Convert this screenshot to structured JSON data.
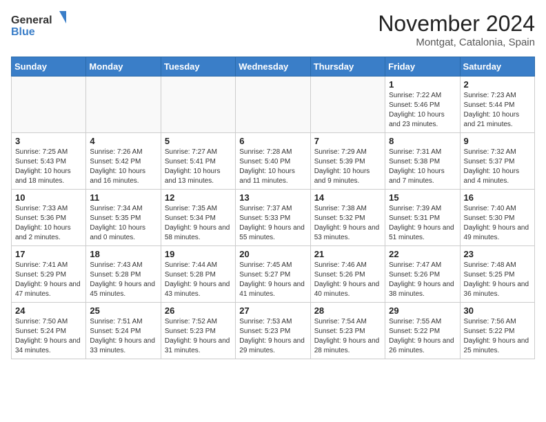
{
  "logo": {
    "general": "General",
    "blue": "Blue"
  },
  "header": {
    "month": "November 2024",
    "location": "Montgat, Catalonia, Spain"
  },
  "days_of_week": [
    "Sunday",
    "Monday",
    "Tuesday",
    "Wednesday",
    "Thursday",
    "Friday",
    "Saturday"
  ],
  "weeks": [
    [
      {
        "day": "",
        "info": ""
      },
      {
        "day": "",
        "info": ""
      },
      {
        "day": "",
        "info": ""
      },
      {
        "day": "",
        "info": ""
      },
      {
        "day": "",
        "info": ""
      },
      {
        "day": "1",
        "info": "Sunrise: 7:22 AM\nSunset: 5:46 PM\nDaylight: 10 hours and 23 minutes."
      },
      {
        "day": "2",
        "info": "Sunrise: 7:23 AM\nSunset: 5:44 PM\nDaylight: 10 hours and 21 minutes."
      }
    ],
    [
      {
        "day": "3",
        "info": "Sunrise: 7:25 AM\nSunset: 5:43 PM\nDaylight: 10 hours and 18 minutes."
      },
      {
        "day": "4",
        "info": "Sunrise: 7:26 AM\nSunset: 5:42 PM\nDaylight: 10 hours and 16 minutes."
      },
      {
        "day": "5",
        "info": "Sunrise: 7:27 AM\nSunset: 5:41 PM\nDaylight: 10 hours and 13 minutes."
      },
      {
        "day": "6",
        "info": "Sunrise: 7:28 AM\nSunset: 5:40 PM\nDaylight: 10 hours and 11 minutes."
      },
      {
        "day": "7",
        "info": "Sunrise: 7:29 AM\nSunset: 5:39 PM\nDaylight: 10 hours and 9 minutes."
      },
      {
        "day": "8",
        "info": "Sunrise: 7:31 AM\nSunset: 5:38 PM\nDaylight: 10 hours and 7 minutes."
      },
      {
        "day": "9",
        "info": "Sunrise: 7:32 AM\nSunset: 5:37 PM\nDaylight: 10 hours and 4 minutes."
      }
    ],
    [
      {
        "day": "10",
        "info": "Sunrise: 7:33 AM\nSunset: 5:36 PM\nDaylight: 10 hours and 2 minutes."
      },
      {
        "day": "11",
        "info": "Sunrise: 7:34 AM\nSunset: 5:35 PM\nDaylight: 10 hours and 0 minutes."
      },
      {
        "day": "12",
        "info": "Sunrise: 7:35 AM\nSunset: 5:34 PM\nDaylight: 9 hours and 58 minutes."
      },
      {
        "day": "13",
        "info": "Sunrise: 7:37 AM\nSunset: 5:33 PM\nDaylight: 9 hours and 55 minutes."
      },
      {
        "day": "14",
        "info": "Sunrise: 7:38 AM\nSunset: 5:32 PM\nDaylight: 9 hours and 53 minutes."
      },
      {
        "day": "15",
        "info": "Sunrise: 7:39 AM\nSunset: 5:31 PM\nDaylight: 9 hours and 51 minutes."
      },
      {
        "day": "16",
        "info": "Sunrise: 7:40 AM\nSunset: 5:30 PM\nDaylight: 9 hours and 49 minutes."
      }
    ],
    [
      {
        "day": "17",
        "info": "Sunrise: 7:41 AM\nSunset: 5:29 PM\nDaylight: 9 hours and 47 minutes."
      },
      {
        "day": "18",
        "info": "Sunrise: 7:43 AM\nSunset: 5:28 PM\nDaylight: 9 hours and 45 minutes."
      },
      {
        "day": "19",
        "info": "Sunrise: 7:44 AM\nSunset: 5:28 PM\nDaylight: 9 hours and 43 minutes."
      },
      {
        "day": "20",
        "info": "Sunrise: 7:45 AM\nSunset: 5:27 PM\nDaylight: 9 hours and 41 minutes."
      },
      {
        "day": "21",
        "info": "Sunrise: 7:46 AM\nSunset: 5:26 PM\nDaylight: 9 hours and 40 minutes."
      },
      {
        "day": "22",
        "info": "Sunrise: 7:47 AM\nSunset: 5:26 PM\nDaylight: 9 hours and 38 minutes."
      },
      {
        "day": "23",
        "info": "Sunrise: 7:48 AM\nSunset: 5:25 PM\nDaylight: 9 hours and 36 minutes."
      }
    ],
    [
      {
        "day": "24",
        "info": "Sunrise: 7:50 AM\nSunset: 5:24 PM\nDaylight: 9 hours and 34 minutes."
      },
      {
        "day": "25",
        "info": "Sunrise: 7:51 AM\nSunset: 5:24 PM\nDaylight: 9 hours and 33 minutes."
      },
      {
        "day": "26",
        "info": "Sunrise: 7:52 AM\nSunset: 5:23 PM\nDaylight: 9 hours and 31 minutes."
      },
      {
        "day": "27",
        "info": "Sunrise: 7:53 AM\nSunset: 5:23 PM\nDaylight: 9 hours and 29 minutes."
      },
      {
        "day": "28",
        "info": "Sunrise: 7:54 AM\nSunset: 5:23 PM\nDaylight: 9 hours and 28 minutes."
      },
      {
        "day": "29",
        "info": "Sunrise: 7:55 AM\nSunset: 5:22 PM\nDaylight: 9 hours and 26 minutes."
      },
      {
        "day": "30",
        "info": "Sunrise: 7:56 AM\nSunset: 5:22 PM\nDaylight: 9 hours and 25 minutes."
      }
    ]
  ]
}
